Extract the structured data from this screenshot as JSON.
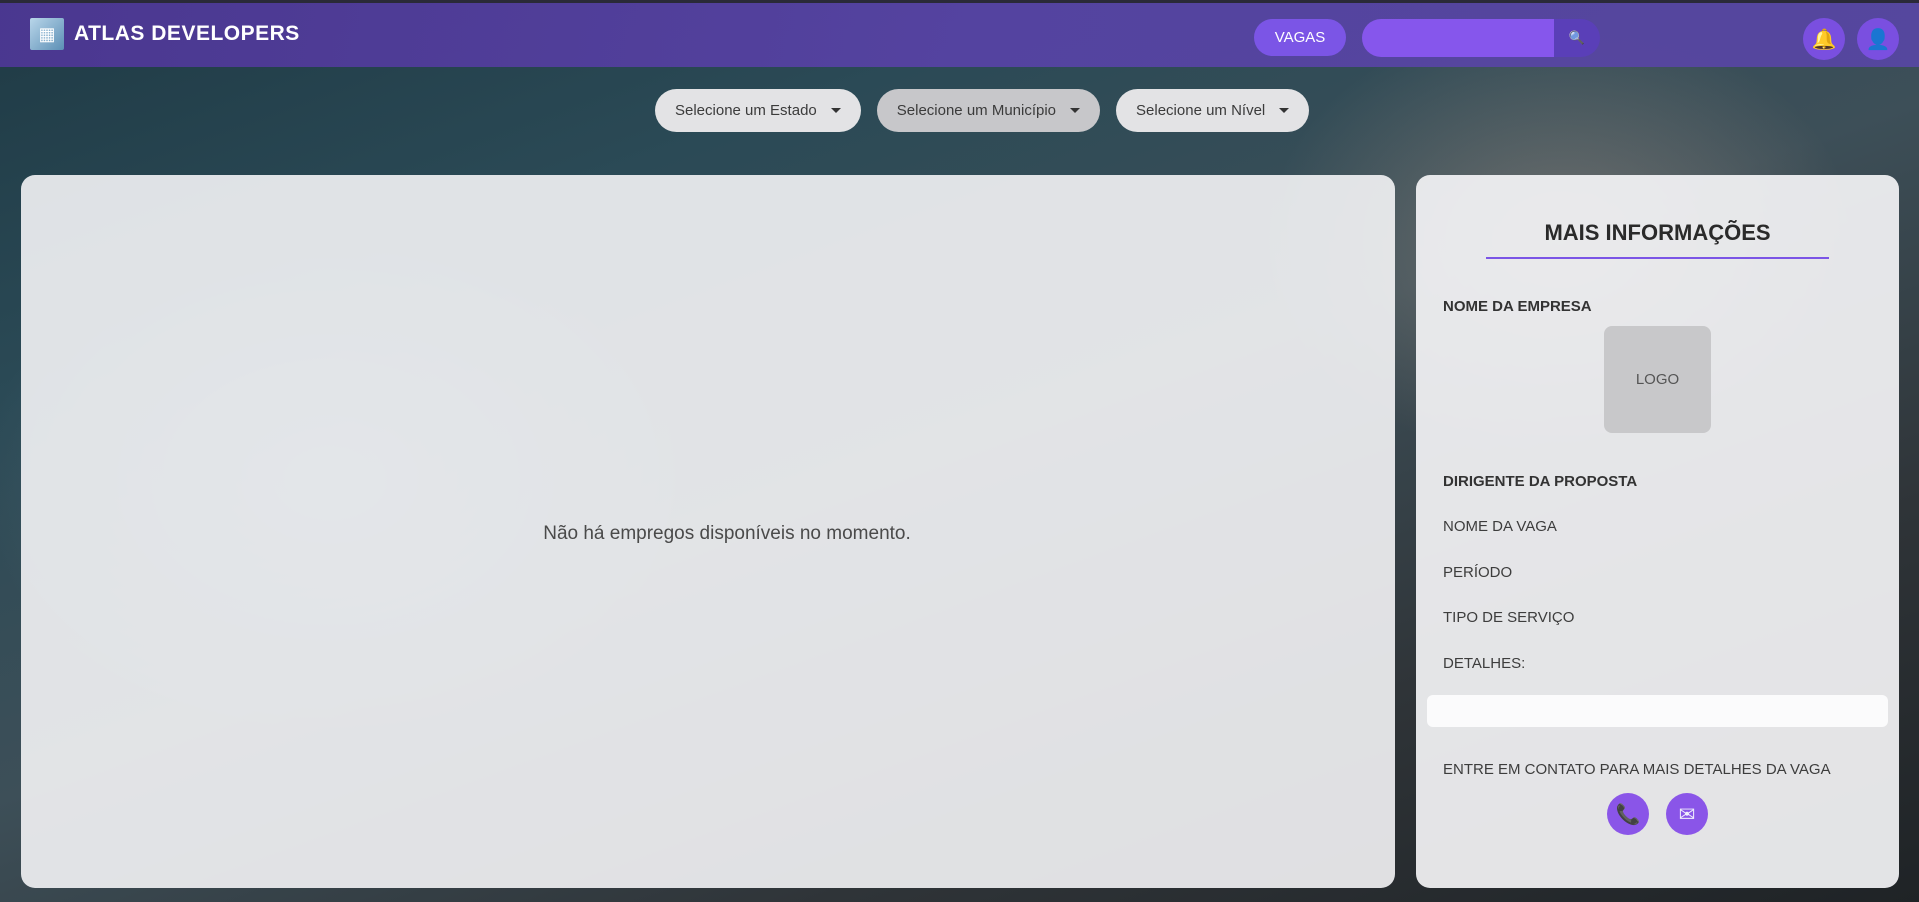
{
  "header": {
    "brand": "ATLAS DEVELOPERS",
    "vagas_label": "VAGAS",
    "search_placeholder": "",
    "search_icon": "search-icon",
    "bell_icon": "bell-icon",
    "user_icon": "user-icon"
  },
  "filters": {
    "estado": "Selecione um Estado",
    "municipio": "Selecione um Município",
    "nivel": "Selecione um Nível"
  },
  "jobs": {
    "empty_message": "Não há empregos disponíveis no momento."
  },
  "info": {
    "title": "MAIS INFORMAÇÕES",
    "company_label": "NOME DA EMPRESA",
    "logo_label": "LOGO",
    "proposer_label": "DIRIGENTE DA PROPOSTA",
    "job_name_label": "NOME DA VAGA",
    "period_label": "PERÍODO",
    "service_type_label": "TIPO DE SERVIÇO",
    "details_label": "DETALHES:",
    "contact_text": "ENTRE EM CONTATO PARA MAIS DETALHES DA VAGA",
    "phone_icon": "phone-icon",
    "mail_icon": "mail-icon"
  },
  "colors": {
    "accent": "#7b55e6",
    "topbar": "#5a42aa"
  }
}
